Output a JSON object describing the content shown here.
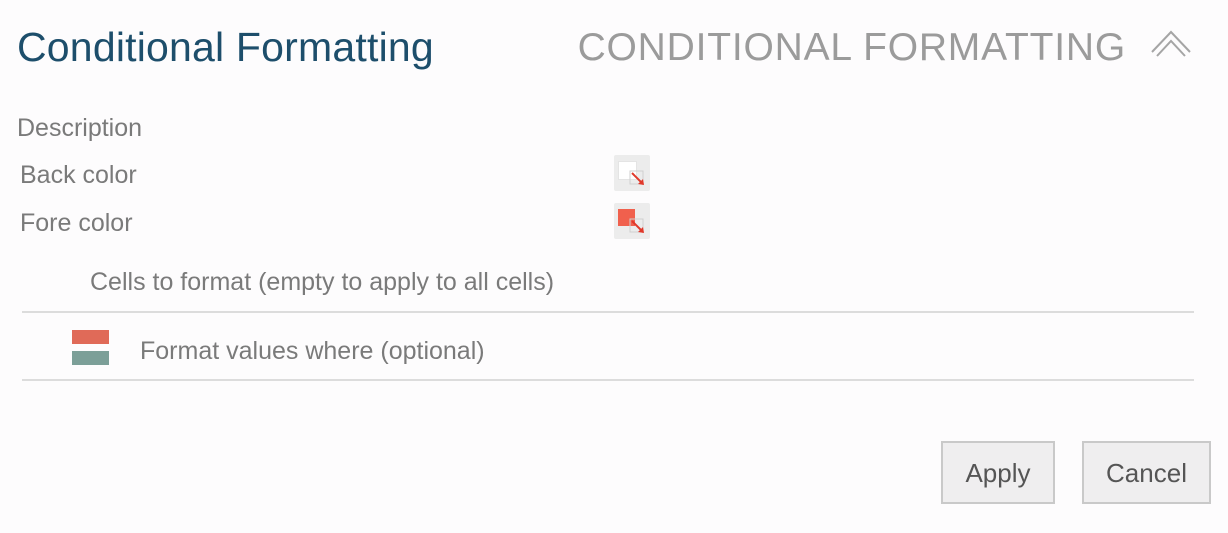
{
  "dialog": {
    "title": "Conditional Formatting",
    "section_header": "CONDITIONAL FORMATTING",
    "collapse_icon": "chevron-up-icon"
  },
  "fields": {
    "description_label": "Description",
    "back_color_label": "Back color",
    "back_color_value": "#ffffff",
    "fore_color_label": "Fore color",
    "fore_color_value": "#f0604d",
    "picker_accent": "#e0392b"
  },
  "cells": {
    "label": "Cells to format (empty to apply to all cells)"
  },
  "format_values": {
    "label": "Format values where (optional)",
    "icon": "format-rules-icon",
    "icon_colors": [
      "#e06a58",
      "#7c9f98"
    ]
  },
  "buttons": {
    "apply_label": "Apply",
    "cancel_label": "Cancel"
  }
}
